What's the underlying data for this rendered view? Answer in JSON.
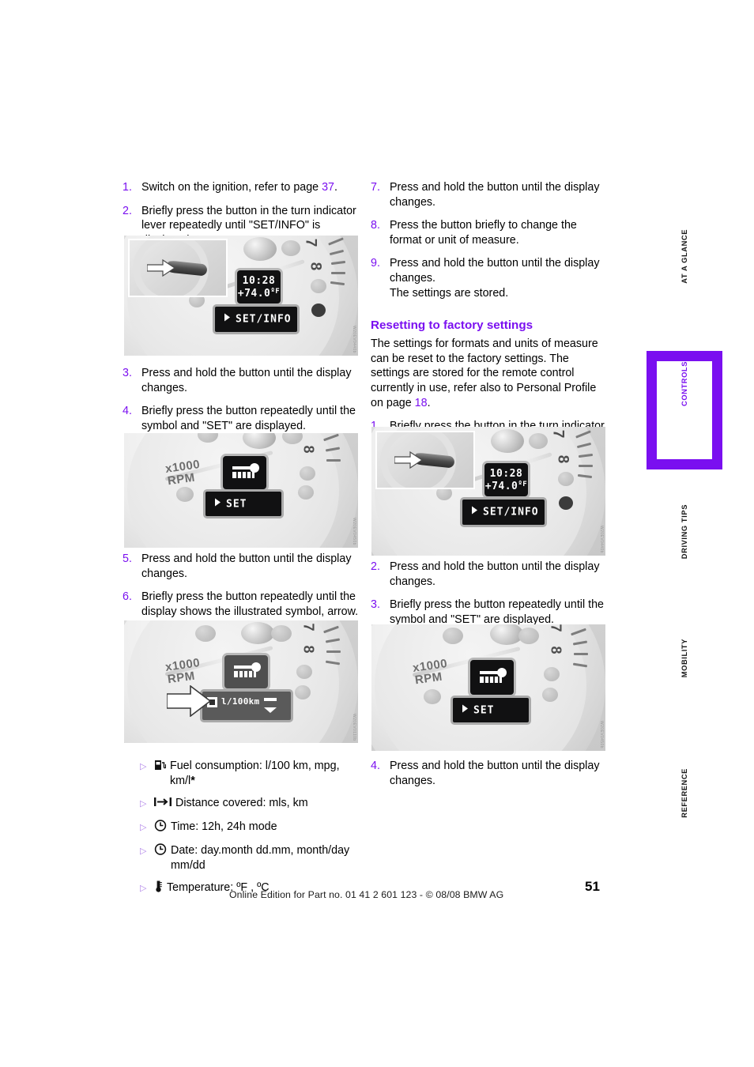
{
  "document": {
    "page_number": "51",
    "footer": "Online Edition for Part no. 01 41 2 601 123  - © 08/08 BMW AG"
  },
  "section_tabs": [
    {
      "label": "AT A GLANCE",
      "active": false
    },
    {
      "label": "CONTROLS",
      "active": true
    },
    {
      "label": "DRIVING TIPS",
      "active": false
    },
    {
      "label": "MOBILITY",
      "active": false
    },
    {
      "label": "REFERENCE",
      "active": false
    }
  ],
  "colors": {
    "accent_purple": "#7a0ff0",
    "bullet_marker": "#b083e8",
    "text": "#000000"
  },
  "left_column": {
    "steps_part1": [
      {
        "num": "1.",
        "text": "Switch on the ignition, refer to page ",
        "ref": "37",
        "tail": "."
      },
      {
        "num": "2.",
        "text": "Briefly press the button in the turn indicator lever repeatedly until \"SET/INFO\" is displayed."
      }
    ],
    "steps_part2": [
      {
        "num": "3.",
        "text": "Press and hold the button until the display changes."
      },
      {
        "num": "4.",
        "text": "Briefly press the button repeatedly until the symbol and \"SET\" are displayed."
      }
    ],
    "steps_part3": [
      {
        "num": "5.",
        "text": "Press and hold the button until the display changes."
      },
      {
        "num": "6.",
        "text": "Briefly press the button repeatedly until the display shows the illustrated symbol, arrow."
      }
    ],
    "bullets": [
      {
        "icon": "fuel-pump-icon",
        "text": "Fuel consumption: l/100 km, mpg, km/l",
        "star": "*"
      },
      {
        "icon": "distance-icon",
        "text": "Distance covered: mls, km",
        "star": ""
      },
      {
        "icon": "clock-icon",
        "text": "Time: 12h, 24h mode",
        "star": ""
      },
      {
        "icon": "clock-icon",
        "text": "Date: day.month dd.mm, month/day mm/dd",
        "star": ""
      },
      {
        "icon": "thermometer-icon",
        "text": "Temperature: ºF , ºC",
        "star": ""
      }
    ]
  },
  "right_column": {
    "steps_part1": [
      {
        "num": "7.",
        "text": "Press and hold the button until the display changes."
      },
      {
        "num": "8.",
        "text": "Press the button briefly to change the format or unit of measure."
      },
      {
        "num": "9.",
        "text": "Press and hold the button until the display changes.",
        "sub": "The settings are stored."
      }
    ],
    "heading": "Resetting to factory settings",
    "paragraph_lead": "The settings for formats and units of measure can be reset to the factory settings. The settings are stored for the remote control currently in use, refer also to Personal Profile on page ",
    "paragraph_ref": "18",
    "paragraph_tail": ".",
    "steps_part2": [
      {
        "num": "1.",
        "text": "Briefly press the button in the turn indicator lever repeatedly until \"SET/INFO\" is displayed."
      }
    ],
    "steps_part3": [
      {
        "num": "2.",
        "text": "Press and hold the button until the display changes."
      },
      {
        "num": "3.",
        "text": "Briefly press the button repeatedly until the symbol and \"SET\" are displayed."
      }
    ],
    "steps_part4": [
      {
        "num": "4.",
        "text": "Press and hold the button until the display changes."
      }
    ]
  },
  "illustrations": {
    "fig1": {
      "name": "instrument-cluster-setinfo",
      "lcd_time": "10:28",
      "lcd_temp": "+74.0",
      "lcd_temp_unit": "ºF",
      "lcd_bar": "SET/INFO",
      "rpm_label": "",
      "tick_label": "8",
      "code": "W20EV0440b"
    },
    "fig2": {
      "name": "instrument-cluster-set-key",
      "lcd_symbol": "key-mini-icon",
      "lcd_bar": "SET",
      "rpm_label_1": "x1000",
      "rpm_label_2": "RPM",
      "tick_label": "8",
      "code": "W20EV0450b"
    },
    "fig3": {
      "name": "instrument-cluster-fuel-consumption",
      "lcd_symbol": "key-mini-icon",
      "lcd_bar": "l/100km",
      "rpm_label_1": "x1000",
      "rpm_label_2": "RPM",
      "tick_label": "8",
      "code": "W20EV0110b"
    },
    "fig4": {
      "name": "instrument-cluster-setinfo-reset",
      "lcd_time": "10:28",
      "lcd_temp": "+74.0",
      "lcd_temp_unit": "ºF",
      "lcd_bar": "SET/INFO",
      "tick_label": "8",
      "code": "W20EV0440b"
    },
    "fig5": {
      "name": "instrument-cluster-set-key-reset",
      "lcd_symbol": "key-mini-icon",
      "lcd_bar": "SET",
      "rpm_label_1": "x1000",
      "rpm_label_2": "RPM",
      "tick_label": "8",
      "code": "W20EV0450b"
    }
  }
}
